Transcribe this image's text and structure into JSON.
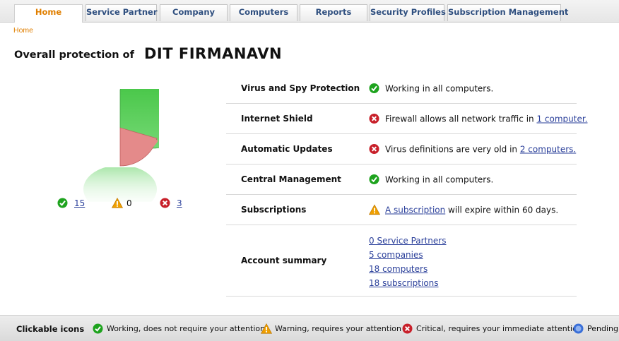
{
  "tabs": [
    {
      "label": "Home",
      "active": true
    },
    {
      "label": "Service Partner"
    },
    {
      "label": "Company"
    },
    {
      "label": "Computers"
    },
    {
      "label": "Reports"
    },
    {
      "label": "Security Profiles"
    },
    {
      "label": "Subscription Management"
    }
  ],
  "breadcrumb": "Home",
  "page_title": "Overall protection of",
  "company_name": "DIT FIRMANAVN",
  "summary_counts": {
    "ok": "15",
    "warning": "0",
    "critical": "3"
  },
  "status_rows": [
    {
      "label": "Virus and Spy Protection",
      "status": "ok",
      "text": "Working in all computers."
    },
    {
      "label": "Internet Shield",
      "status": "critical",
      "text": "Firewall allows all network traffic in ",
      "link": "1 computer."
    },
    {
      "label": "Automatic Updates",
      "status": "critical",
      "text": "Virus definitions are very old in ",
      "link": "2 computers."
    },
    {
      "label": "Central Management",
      "status": "ok",
      "text": "Working in all computers."
    },
    {
      "label": "Subscriptions",
      "status": "warning",
      "link": "A subscription",
      "text": " will expire within 60 days."
    }
  ],
  "account_summary": {
    "label": "Account summary",
    "links": [
      "0 Service Partners",
      "5 companies",
      "18 computers",
      "18 subscriptions"
    ]
  },
  "legend": {
    "title": "Clickable icons",
    "ok": "Working, does not require your attention",
    "warning": "Warning, requires your attention",
    "critical": "Critical, requires your immediate attention",
    "pending": "Pending"
  },
  "colors": {
    "ok": "#1ea31e",
    "warning": "#f0a000",
    "critical": "#c8202a",
    "pending": "#3a6fd8",
    "tab_active_text": "#e07f00",
    "link": "#2a3f9a"
  }
}
